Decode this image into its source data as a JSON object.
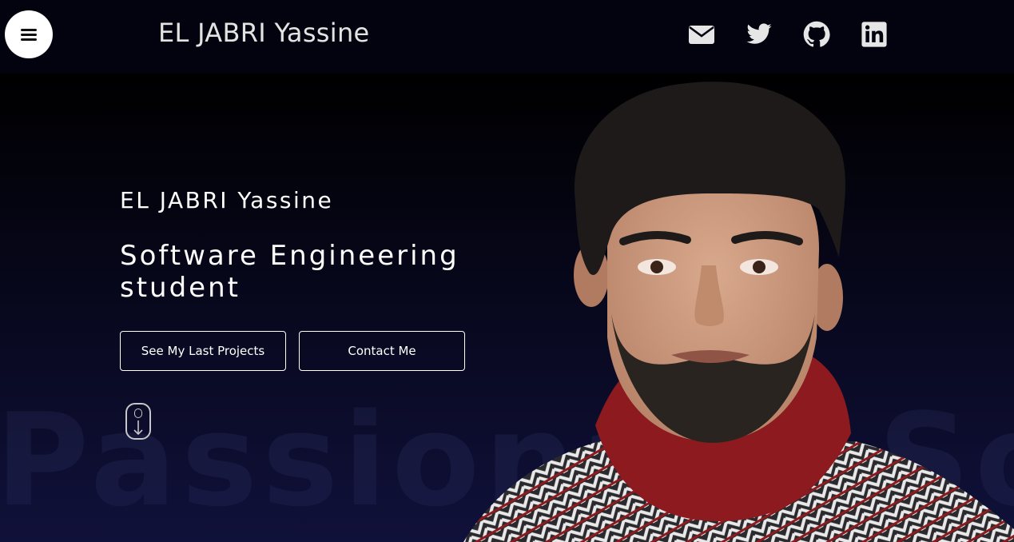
{
  "header": {
    "title": "EL JABRI Yassine",
    "menu_icon": "hamburger-icon",
    "social": [
      {
        "name": "email",
        "icon": "envelope-icon"
      },
      {
        "name": "twitter",
        "icon": "twitter-icon"
      },
      {
        "name": "github",
        "icon": "github-icon"
      },
      {
        "name": "linkedin",
        "icon": "linkedin-icon"
      }
    ]
  },
  "hero": {
    "name": "EL JABRI Yassine",
    "role": "Software Engineering student",
    "buttons": {
      "projects": "See My Last Projects",
      "contact": "Contact Me"
    },
    "scroll_icon": "mouse-scroll-icon",
    "watermark": "Passionate Soft"
  },
  "colors": {
    "header_bg": "#03030f",
    "hero_gradient_top": "#000000",
    "hero_gradient_bottom": "#10113a",
    "text": "#ffffff",
    "sweater_red": "#8c1a1e"
  }
}
